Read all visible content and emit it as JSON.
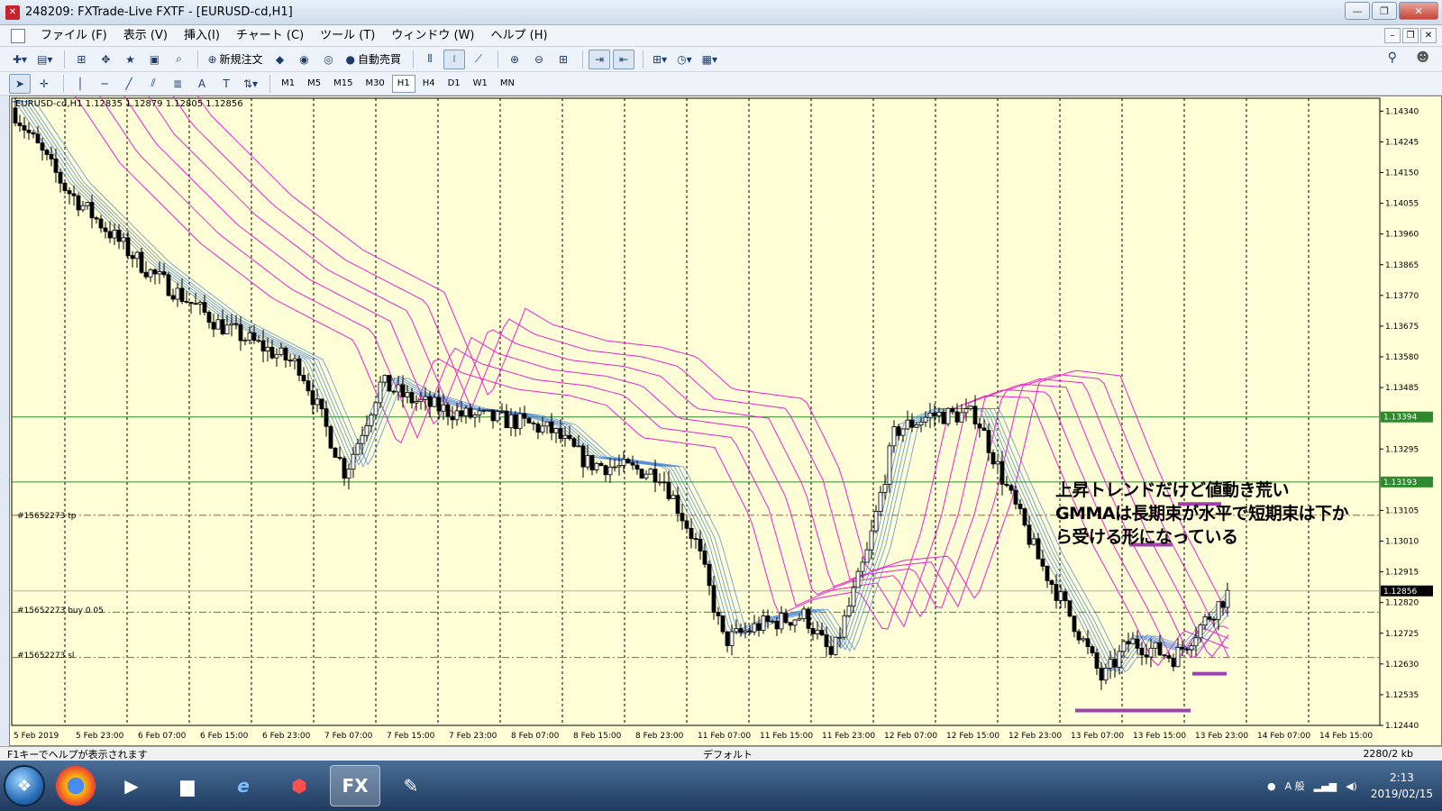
{
  "window": {
    "title": "248209: FXTrade-Live FXTF - [EURUSD-cd,H1]"
  },
  "menu": [
    "ファイル (F)",
    "表示 (V)",
    "挿入(I)",
    "チャート (C)",
    "ツール (T)",
    "ウィンドウ (W)",
    "ヘルプ (H)"
  ],
  "toolbar": {
    "new_order": "新規注文",
    "auto_trade": "自動売買"
  },
  "timeframes": [
    "M1",
    "M5",
    "M15",
    "M30",
    "H1",
    "H4",
    "D1",
    "W1",
    "MN"
  ],
  "active_timeframe": "H1",
  "chart": {
    "header": "EURUSD-cd,H1  1.12835 1.12879 1.12805 1.12856",
    "annotation": [
      "上昇トレンドだけど値動き荒い",
      "GMMAは長期束が水平で短期束は下か",
      "ら受ける形になっている"
    ],
    "orders": {
      "tp": "#15652273 tp",
      "buy": "#15652273 buy 0.05",
      "sl": "#15652273 sl"
    }
  },
  "status": {
    "help": "F1キーでヘルプが表示されます",
    "profile": "デフォルト",
    "traffic": "2280/2 kb"
  },
  "taskbar": {
    "time": "2:13",
    "date": "2019/02/15",
    "ime": "A 般"
  },
  "chart_data": {
    "type": "candlestick",
    "symbol": "EURUSD-cd",
    "timeframe": "H1",
    "ohlc_last": {
      "open": 1.12835,
      "high": 1.12879,
      "low": 1.12805,
      "close": 1.12856
    },
    "y_ticks": [
      1.1434,
      1.14245,
      1.1415,
      1.14055,
      1.1396,
      1.13865,
      1.1377,
      1.13675,
      1.1358,
      1.13485,
      1.13394,
      1.13295,
      1.13193,
      1.13105,
      1.1301,
      1.12915,
      1.12856,
      1.1282,
      1.12725,
      1.1263,
      1.12535,
      1.1244
    ],
    "ylim": [
      1.1244,
      1.1438
    ],
    "x_ticks": [
      "5 Feb 2019",
      "5 Feb 23:00",
      "6 Feb 07:00",
      "6 Feb 15:00",
      "6 Feb 23:00",
      "7 Feb 07:00",
      "7 Feb 15:00",
      "7 Feb 23:00",
      "8 Feb 07:00",
      "8 Feb 15:00",
      "8 Feb 23:00",
      "11 Feb 07:00",
      "11 Feb 15:00",
      "11 Feb 23:00",
      "12 Feb 07:00",
      "12 Feb 15:00",
      "12 Feb 23:00",
      "13 Feb 07:00",
      "13 Feb 15:00",
      "13 Feb 23:00",
      "14 Feb 07:00",
      "14 Feb 15:00"
    ],
    "horizontal_lines": [
      {
        "price": 1.13394,
        "color": "#2d8a2d",
        "style": "solid",
        "label": "1.13394"
      },
      {
        "price": 1.13193,
        "color": "#2d8a2d",
        "style": "solid",
        "label": "1.13193"
      },
      {
        "price": 1.1309,
        "color": "#e0402a",
        "style": "dashdot",
        "label": "tp"
      },
      {
        "price": 1.1279,
        "color": "#2d9a2d",
        "style": "dashdot",
        "label": "buy"
      },
      {
        "price": 1.1265,
        "color": "#e0402a",
        "style": "dashdot",
        "label": "sl"
      }
    ],
    "current_price": 1.12856,
    "colors": {
      "background": "#fefed7",
      "bull": "#ffffff",
      "bear": "#000000",
      "gmma_short": "#3a78d8",
      "gmma_long": "#ee22cc",
      "support_marks": "#a040b0"
    }
  }
}
